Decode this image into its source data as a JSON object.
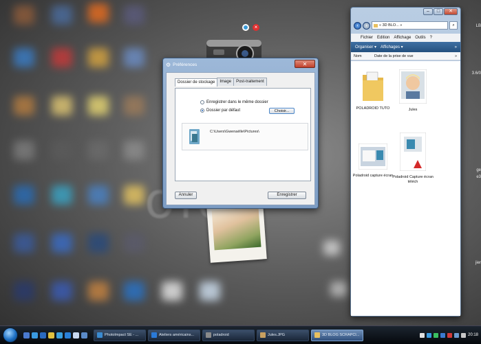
{
  "desktop": {
    "background_text": "oid",
    "right_edge_labels": [
      "LB",
      "3.6/0",
      "ge",
      "e3",
      "jier"
    ]
  },
  "preferences_dialog": {
    "title": "Préférences",
    "close_label": "✕",
    "tabs": [
      "Dossier de stockage",
      "Image",
      "Post-traitement"
    ],
    "active_tab": "Dossier de stockage",
    "option_same_folder": "Enregistrer dans le même dossier",
    "option_default_folder": "Dossier par défaut",
    "selected_option": "Dossier par défaut",
    "choose_button": "Choisir...",
    "folder_path": "C:\\Users\\Gwenaëlle\\Pictures\\",
    "cancel_button": "Annuler",
    "save_button": "Enregistrer"
  },
  "explorer": {
    "address_text": "« 3D BLO... »",
    "search_glyph": "⌕",
    "menu": [
      "Fichier",
      "Edition",
      "Affichage",
      "Outils",
      "?"
    ],
    "toolbar": [
      "Organiser ▾",
      "Affichages ▾",
      "»"
    ],
    "columns": [
      "Nom",
      "Date de la prise de vue",
      "»"
    ],
    "files": [
      {
        "name": "POLADROID TUTO",
        "kind": "folder"
      },
      {
        "name": "Jules",
        "kind": "photo"
      },
      {
        "name": "Poladroid capture écran",
        "kind": "screenshot"
      },
      {
        "name": "Poladroid Capture écran téléch",
        "kind": "pdf"
      }
    ]
  },
  "taskbar": {
    "tasks": [
      {
        "label": "PhotoImpact SE - ...",
        "active": false
      },
      {
        "label": "Ateliers américains...",
        "active": false
      },
      {
        "label": "poladroid",
        "active": false
      },
      {
        "label": "Jules.JPG",
        "active": false
      },
      {
        "label": "3D BLOG SCRAPCI...",
        "active": true
      }
    ],
    "clock": "20:18"
  },
  "colors": {
    "accent_blue": "#1d5ab0",
    "close_red": "#c0402b",
    "taskbar": "#05080c"
  }
}
